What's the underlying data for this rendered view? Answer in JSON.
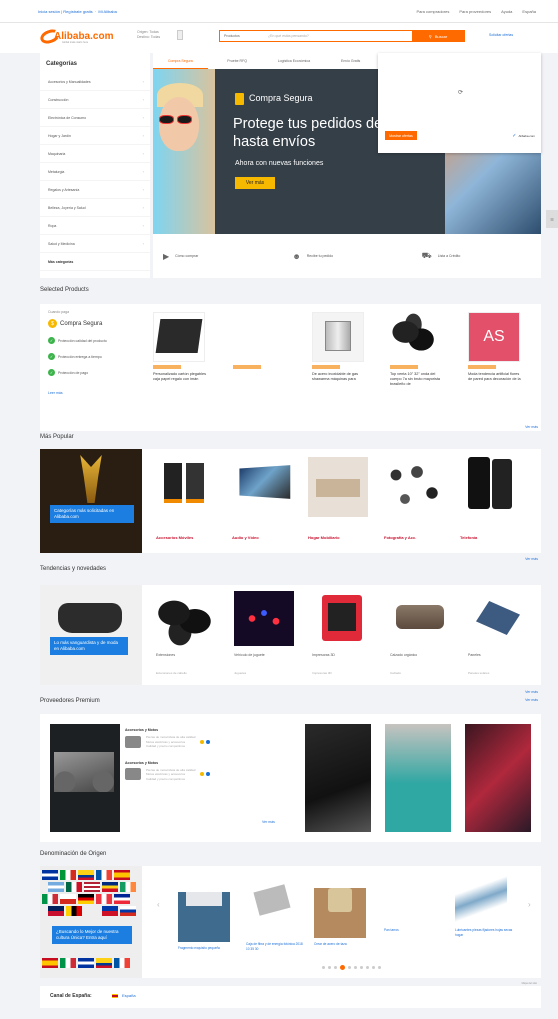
{
  "topbar": {
    "left": "Inicia sesión | Regístrate gratis",
    "lang": "Mi Alibaba",
    "right": [
      "Para compradores",
      "Para proveedores",
      "Ayuda",
      "España"
    ]
  },
  "header": {
    "logo": "Alibaba.com",
    "logo_tag": "Global trade starts here",
    "opt1": "Origen: Todas",
    "opt2": "Destino: Todas",
    "search_cat": "Productos",
    "search_placeholder": "¿En qué estás pensando?",
    "search_btn": "Buscar",
    "post_link": "Solicitar ofertas"
  },
  "categories": {
    "title": "Categorías",
    "items": [
      "Accesorios y Manualidades",
      "Construcción",
      "Electrónica de Consumo",
      "Hogar y Jardín",
      "Maquinaria",
      "Metalurgia",
      "Regalos y Artesanía",
      "Belleza, Joyería y Salud",
      "Ropa",
      "Salud y Medicina",
      "Más categorías"
    ]
  },
  "banner": {
    "tabs": [
      "Compra Segura",
      "Pruebe RFQ",
      "Logística Económica",
      "Envío Gratis"
    ],
    "badge_title": "Compra Segura",
    "headline": "Protege tus pedidos de pagos hasta envíos",
    "sub": "Ahora con nuevas funciones",
    "cta": "Ver más",
    "popup_btn": "Mostrar ofertas",
    "popup_brand": "Alibaba.com",
    "services": [
      "Cómo comprar",
      "Recibe tu pedido",
      "Lista a Crédito"
    ]
  },
  "selected": {
    "title": "Selected Products",
    "small": "Cuando paga",
    "brand": "Compra Segura",
    "features": [
      "Protección calidad del producto",
      "Protección entrega a tiempo",
      "Protección de pago"
    ],
    "link": "Leer más",
    "products": [
      "Personalizado cartón plegables caja papel regalo con imán",
      "",
      "De acero inoxidable de gas shawarma máquinas para",
      "Top venta 10\" 32\" onda del cuerpo 7a sin bruto mayorista brasileño de",
      "Moda tendencia artificial flores de pared para decoración de la"
    ],
    "more": "Ver más"
  },
  "popular": {
    "title": "Más Popular",
    "feature": "Categorías más solicitadas en Alibaba.com",
    "items": [
      "Accesorios Móviles",
      "Audio y Vídeo",
      "Hogar Mobiliario",
      "Fotografía y Acc.",
      "Telefonía"
    ],
    "more": "Ver más"
  },
  "trends": {
    "title": "Tendencias y novedades",
    "feature": "Lo más vanguardista y de moda en Alibaba.com",
    "items": [
      {
        "name": "Extensiones",
        "sub": "Extensiones de cabello"
      },
      {
        "name": "Vehículo de juguete",
        "sub": "Juguetes"
      },
      {
        "name": "Impresoras 3D",
        "sub": "Impresoras 3D"
      },
      {
        "name": "Calzado orgánico",
        "sub": "Calzado"
      },
      {
        "name": "Paneles",
        "sub": "Paneles solares"
      }
    ],
    "more": "Ver más"
  },
  "premium": {
    "title": "Proveedores Premium",
    "groups": [
      "Accesorios y Motos",
      "Accesorios y Motos"
    ],
    "rows": [
      "Piezas de motocicleta de alta calidad",
      "Motos eléctricas y accesorios",
      "Calidad y precio competitivos"
    ],
    "view_more": "Ver más",
    "more": "Ver más"
  },
  "origin": {
    "title": "Denominación de Origen",
    "feature": "¿Buscando lo Mejor de nuestra cultura Única? Entra aquí",
    "items": [
      "Fragmento exquisito pequeño",
      "Caja de fibra y de energía fotónica 2018 10 35 30",
      "Crear de acero de taza",
      "Pan tarros",
      "Lubricantes piezas fijadores hojas secas hogar"
    ]
  },
  "footer": {
    "label": "Canal de España:",
    "country": "España",
    "small": "Mapa del sitio"
  },
  "colors": {
    "accent": "#ff6a00",
    "link": "#1a6ed8",
    "gold": "#f7b800",
    "popular_label": "#c8102e"
  }
}
